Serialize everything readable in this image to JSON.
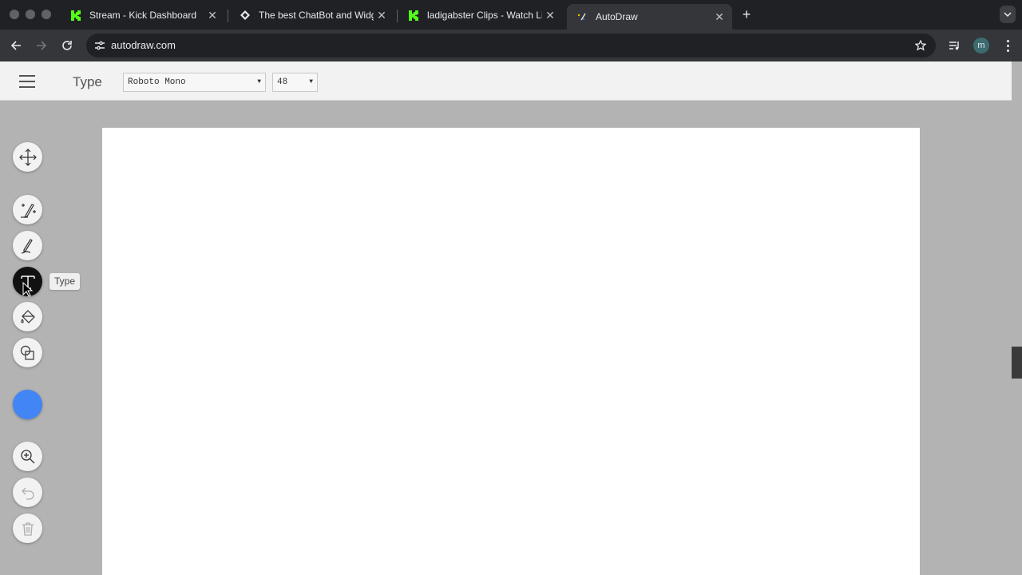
{
  "browser": {
    "tabs": [
      {
        "title": "Stream - Kick Dashboard",
        "favicon": "kick-logo-icon",
        "active": false
      },
      {
        "title": "The best ChatBot and Widgets",
        "favicon": "botrix-logo-icon",
        "active": false
      },
      {
        "title": "ladigabster Clips - Watch Live",
        "favicon": "kick-logo-icon",
        "active": false
      },
      {
        "title": "AutoDraw",
        "favicon": "autodraw-logo-icon",
        "active": true
      }
    ],
    "url": "autodraw.com",
    "profile_initial": "m"
  },
  "app": {
    "tool_name": "Type",
    "font_select": {
      "value": "Roboto Mono"
    },
    "size_select": {
      "value": "48"
    },
    "tooltip": "Type",
    "tools": [
      {
        "name": "select-tool",
        "icon": "move-arrows-icon"
      },
      {
        "name": "autodraw-tool",
        "icon": "autodraw-pen-icon"
      },
      {
        "name": "draw-tool",
        "icon": "pencil-icon"
      },
      {
        "name": "type-tool",
        "icon": "text-icon",
        "active": true
      },
      {
        "name": "fill-tool",
        "icon": "paint-bucket-icon"
      },
      {
        "name": "shape-tool",
        "icon": "shapes-icon"
      }
    ],
    "current_color": "#4285f4",
    "accent": "#111111"
  }
}
